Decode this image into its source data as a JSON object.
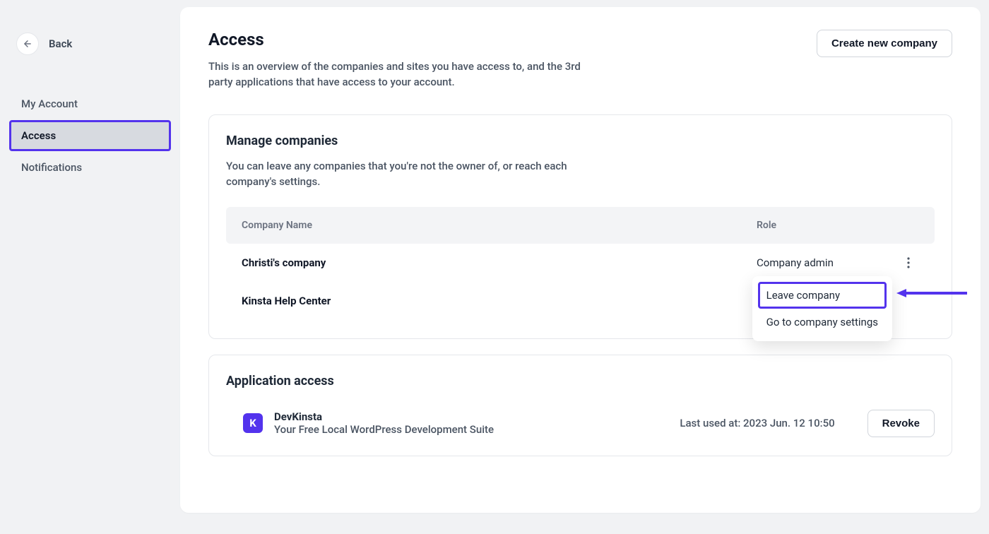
{
  "sidebar": {
    "back_label": "Back",
    "items": [
      {
        "label": "My Account"
      },
      {
        "label": "Access"
      },
      {
        "label": "Notifications"
      }
    ],
    "active_index": 1
  },
  "header": {
    "title": "Access",
    "subtitle": "This is an overview of the companies and sites you have access to, and the 3rd party applications that have access to your account.",
    "create_button": "Create new company"
  },
  "manage_companies": {
    "title": "Manage companies",
    "subtitle": "You can leave any companies that you're not the owner of, or reach each company's settings.",
    "columns": {
      "name": "Company Name",
      "role": "Role"
    },
    "rows": [
      {
        "name": "Christi's company",
        "role": "Company admin"
      },
      {
        "name": "Kinsta Help Center",
        "role": ""
      }
    ],
    "dropdown": {
      "leave": "Leave company",
      "settings": "Go to company settings"
    }
  },
  "application_access": {
    "title": "Application access",
    "app": {
      "logo_letter": "K",
      "name": "DevKinsta",
      "description": "Your Free Local WordPress Development Suite",
      "last_used_label": "Last used at:",
      "last_used_value": "2023 Jun. 12 10:50",
      "revoke": "Revoke"
    }
  }
}
